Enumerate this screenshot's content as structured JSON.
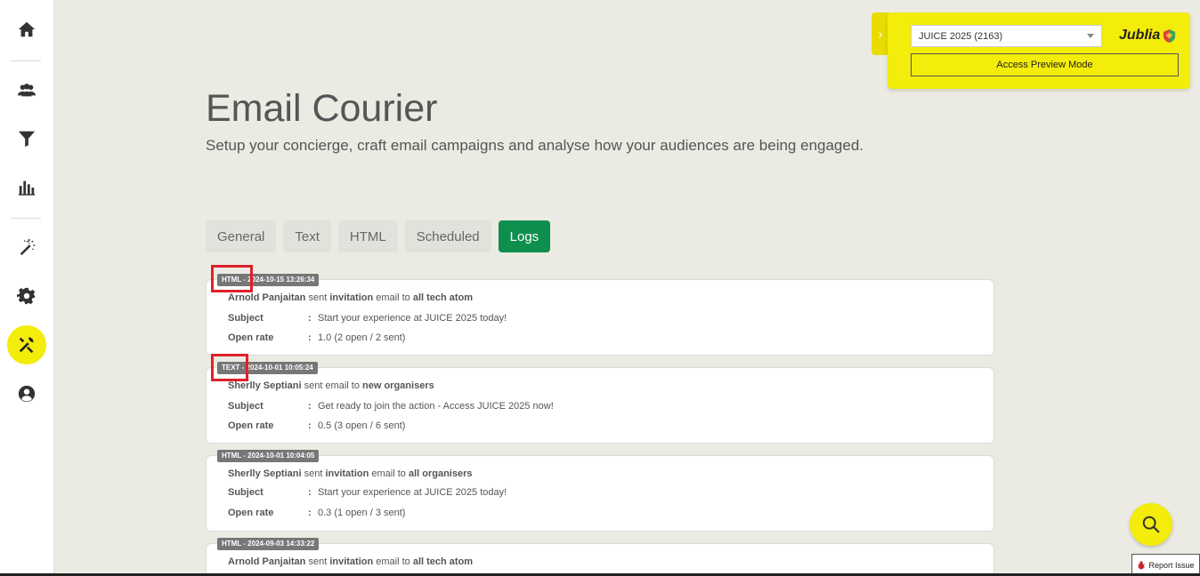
{
  "sidebar": {
    "items": [
      {
        "name": "home-icon"
      },
      {
        "name": "people-icon"
      },
      {
        "name": "filter-icon"
      },
      {
        "name": "bar-chart-icon"
      },
      {
        "name": "magic-wand-icon"
      },
      {
        "name": "gear-icon"
      },
      {
        "name": "tools-icon",
        "active": true
      },
      {
        "name": "user-circle-icon"
      }
    ],
    "active_color": "#f4ec0a"
  },
  "header": {
    "title": "Email Courier",
    "subtitle": "Setup your concierge, craft email campaigns and analyse how your audiences are being engaged."
  },
  "tabs": [
    {
      "label": "General"
    },
    {
      "label": "Text"
    },
    {
      "label": "HTML"
    },
    {
      "label": "Scheduled"
    },
    {
      "label": "Logs",
      "active": true
    }
  ],
  "logs": [
    {
      "badge": "HTML - 2024-10-15 13:26:34",
      "sender": "Arnold Panjaitan",
      "verb": " sent ",
      "kind": "invitation",
      "mid": " email to ",
      "audience": "all tech atom",
      "subject_label": "Subject",
      "subject": "Start your experience at JUICE 2025 today!",
      "rate_label": "Open rate",
      "rate": "1.0 (2 open / 2 sent)"
    },
    {
      "badge": "TEXT - 2024-10-01 10:05:24",
      "sender": "Sherlly Septiani",
      "verb": " sent email to ",
      "kind": "",
      "mid": "",
      "audience": "new organisers",
      "subject_label": "Subject",
      "subject": "Get ready to join the action - Access JUICE 2025 now!",
      "rate_label": "Open rate",
      "rate": "0.5 (3 open / 6 sent)"
    },
    {
      "badge": "HTML - 2024-10-01 10:04:05",
      "sender": "Sherlly Septiani",
      "verb": " sent ",
      "kind": "invitation",
      "mid": " email to ",
      "audience": "all organisers",
      "subject_label": "Subject",
      "subject": "Start your experience at JUICE 2025 today!",
      "rate_label": "Open rate",
      "rate": "0.3 (1 open / 3 sent)"
    },
    {
      "badge": "HTML - 2024-09-03 14:33:22",
      "sender": "Arnold Panjaitan",
      "verb": " sent ",
      "kind": "invitation",
      "mid": " email to ",
      "audience": "all tech atom",
      "subject_label": "",
      "subject": "",
      "rate_label": "",
      "rate": ""
    }
  ],
  "panel": {
    "event_select": "JUICE 2025 (2163)",
    "brand": "Jublia",
    "preview_button": "Access Preview Mode",
    "color": "#f4ec0a"
  },
  "report_issue": "Report Issue",
  "colors": {
    "accent_green": "#0e8f4e",
    "background": "#ebebe3",
    "highlight_red": "#e0202a"
  }
}
